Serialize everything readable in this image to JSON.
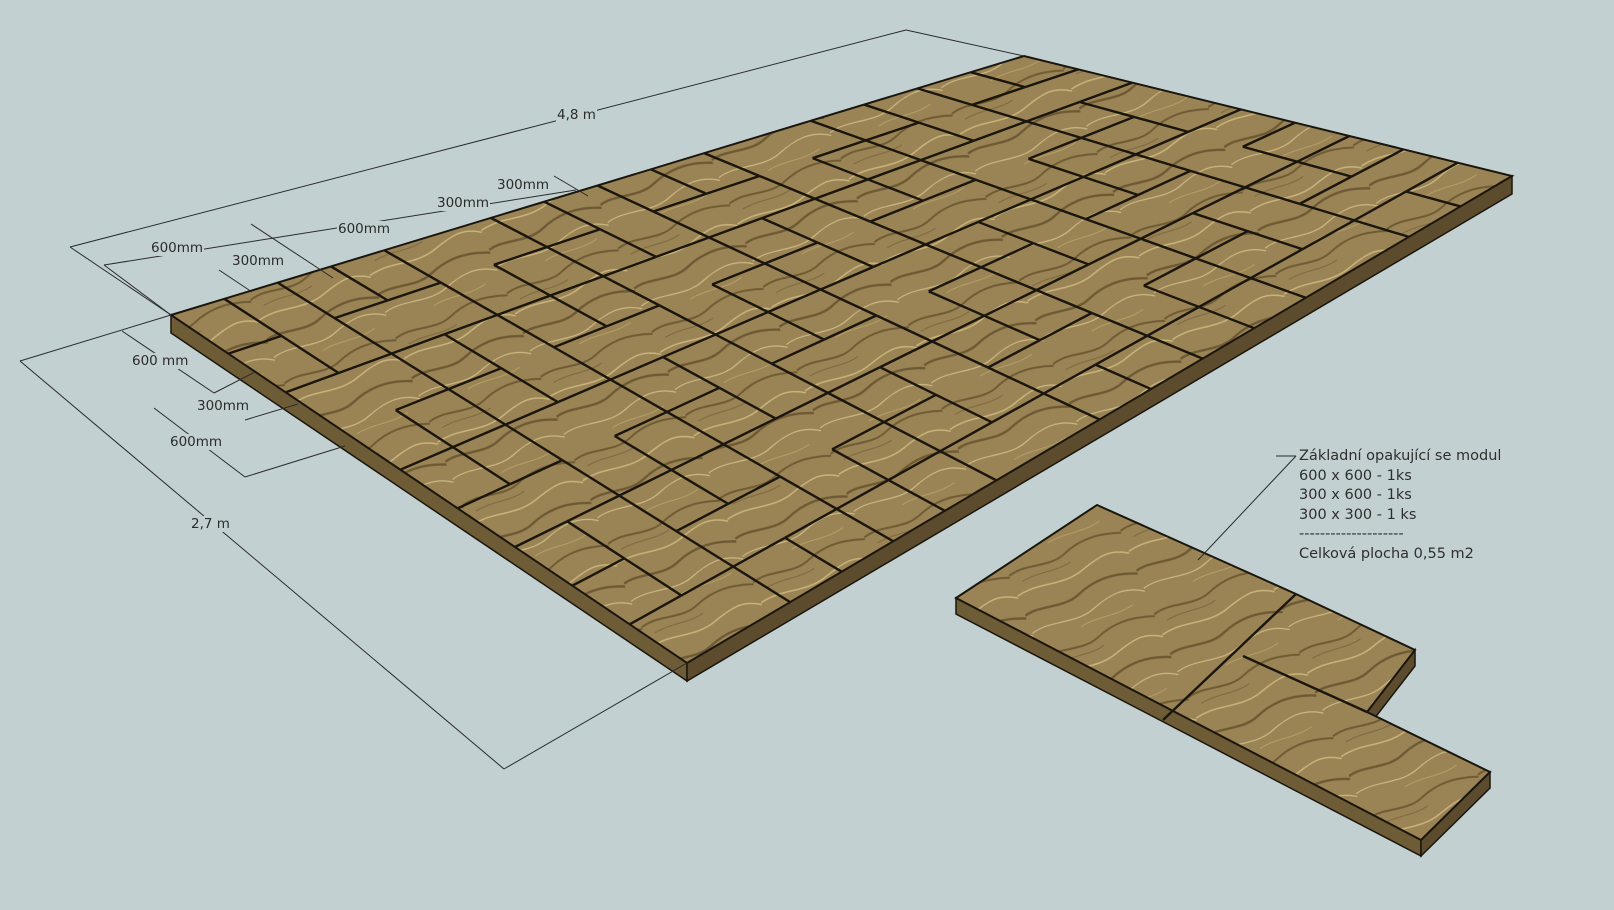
{
  "dimensions": {
    "total_length": "4,8 m",
    "total_width": "2,7 m",
    "top_600a": "600mm",
    "top_300a": "300mm",
    "top_600b": "600mm",
    "top_300b": "300mm",
    "top_300c": "300mm",
    "side_600a": "600 mm",
    "side_300": "300mm",
    "side_600b": "600mm"
  },
  "module_note": {
    "title": "Základní opakující se modul",
    "line1": "600 x 600 - 1ks",
    "line2": "300 x 600 - 1ks",
    "line3": "300 x 300 - 1 ks",
    "separator": "--------------------",
    "total": "Celková plocha 0,55 m2"
  },
  "colors": {
    "background": "#c3d0d2",
    "tile": "#9a8354",
    "tile_side": "#6e5c37",
    "joint": "#1a160d",
    "dim_line": "#2b2b2b"
  }
}
